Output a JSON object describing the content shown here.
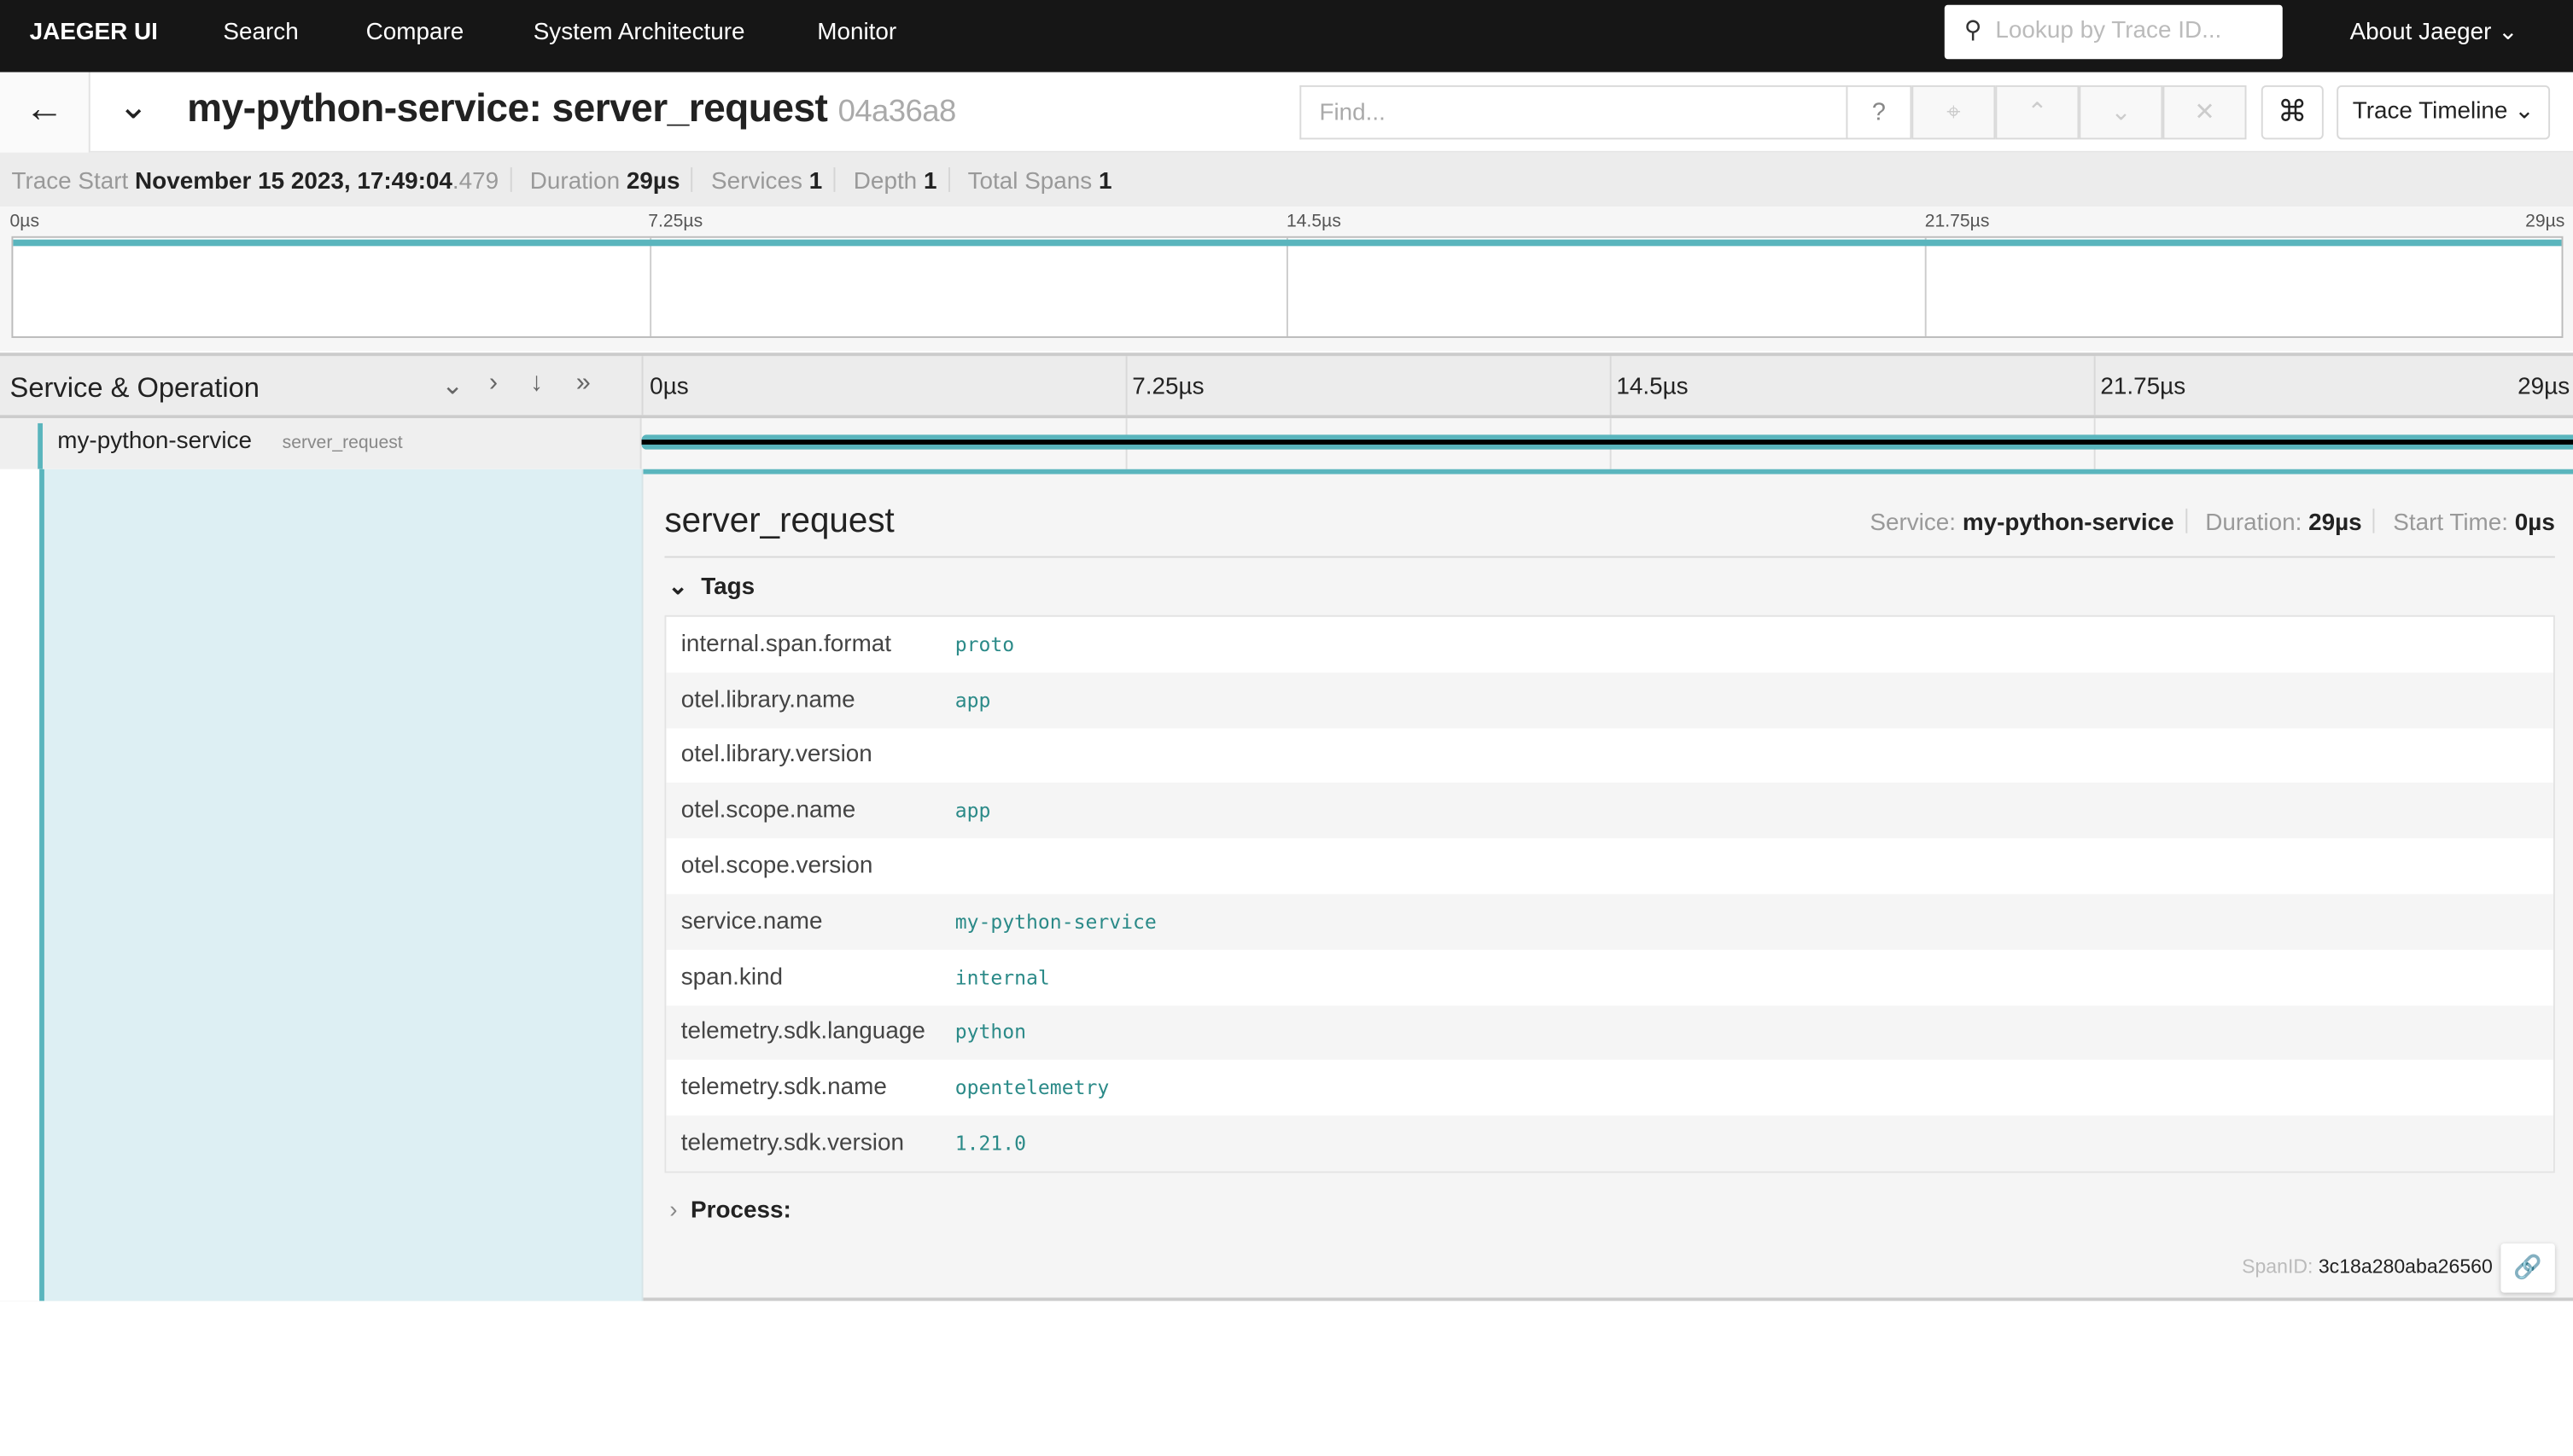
{
  "topbar": {
    "brand": "JAEGER UI",
    "nav": [
      "Search",
      "Compare",
      "System Architecture",
      "Monitor"
    ],
    "lookup_placeholder": "Lookup by Trace ID...",
    "about": "About Jaeger"
  },
  "header": {
    "service": "my-python-service: server_request",
    "trace_id": "04a36a8",
    "find_placeholder": "Find...",
    "view_select": "Trace Timeline"
  },
  "summary": {
    "trace_start_label": "Trace Start",
    "trace_start": "November 15 2023, 17:49:04",
    "trace_start_ms": ".479",
    "duration_label": "Duration",
    "duration": "29µs",
    "services_label": "Services",
    "services": "1",
    "depth_label": "Depth",
    "depth": "1",
    "total_spans_label": "Total Spans",
    "total_spans": "1"
  },
  "ticks": [
    "0µs",
    "7.25µs",
    "14.5µs",
    "21.75µs",
    "29µs"
  ],
  "timeline": {
    "header": "Service & Operation",
    "span_service": "my-python-service",
    "span_operation": "server_request",
    "accent": "#5ab5bd"
  },
  "detail": {
    "operation": "server_request",
    "service_label": "Service:",
    "service": "my-python-service",
    "duration_label": "Duration:",
    "duration": "29µs",
    "start_label": "Start Time:",
    "start": "0µs",
    "tags_label": "Tags",
    "process_label": "Process:",
    "spanid_label": "SpanID:",
    "spanid": "3c18a280aba26560",
    "tags": [
      {
        "k": "internal.span.format",
        "v": "proto"
      },
      {
        "k": "otel.library.name",
        "v": "app"
      },
      {
        "k": "otel.library.version",
        "v": ""
      },
      {
        "k": "otel.scope.name",
        "v": "app"
      },
      {
        "k": "otel.scope.version",
        "v": ""
      },
      {
        "k": "service.name",
        "v": "my-python-service"
      },
      {
        "k": "span.kind",
        "v": "internal"
      },
      {
        "k": "telemetry.sdk.language",
        "v": "python"
      },
      {
        "k": "telemetry.sdk.name",
        "v": "opentelemetry"
      },
      {
        "k": "telemetry.sdk.version",
        "v": "1.21.0"
      }
    ]
  }
}
